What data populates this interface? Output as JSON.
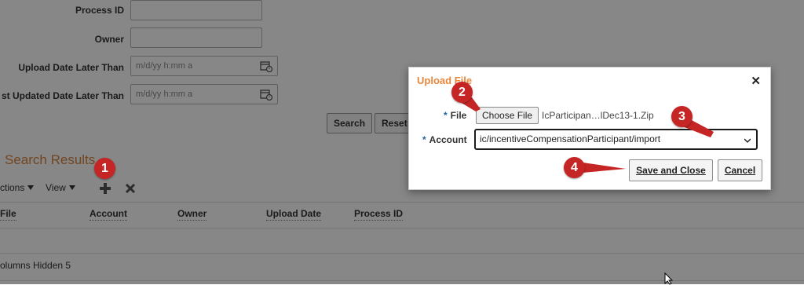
{
  "search_form": {
    "process_id_label": "Process ID",
    "owner_label": "Owner",
    "upload_date_label": "Upload Date Later Than",
    "upload_date_placeholder": "m/d/yy h:mm a",
    "last_updated_label": "st Updated Date Later Than",
    "last_updated_placeholder": "m/d/yy h:mm a",
    "search_button": "Search",
    "reset_button": "Reset"
  },
  "results": {
    "title": "Search Results",
    "actions_menu": "ctions",
    "view_menu": "View",
    "columns": [
      "File",
      "Account",
      "Owner",
      "Upload Date",
      "Process ID"
    ],
    "columns_hidden_text": "olumns Hidden 5"
  },
  "dialog": {
    "title": "Upload File",
    "close_glyph": "✕",
    "file_label": "File",
    "choose_file_button": "Choose File",
    "file_name": "IcParticipan…lDec13-1.Zip",
    "account_label": "Account",
    "account_value": "ic/incentiveCompensationParticipant/import",
    "save_close_button": "Save and Close",
    "cancel_button": "Cancel",
    "required_marker": "*"
  },
  "badges": [
    "1",
    "2",
    "3",
    "4"
  ],
  "colors": {
    "accent_orange": "#e8873c",
    "badge_red": "#c62525",
    "required_blue": "#1a64a4"
  }
}
